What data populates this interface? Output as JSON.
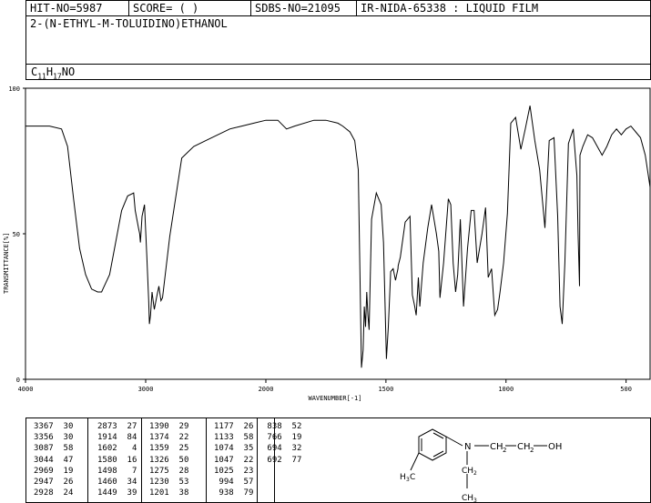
{
  "header": {
    "hit_no": "HIT-NO=5987",
    "score": "SCORE=  (   )",
    "sdbs_no": "SDBS-NO=21095",
    "ir_nida": "IR-NIDA-65338 : LIQUID FILM"
  },
  "compound_name": "2-(N-ETHYL-M-TOLUIDINO)ETHANOL",
  "formula": {
    "c": "C",
    "c_sub": "11",
    "h": "H",
    "h_sub": "17",
    "rest": "NO"
  },
  "chart_data": {
    "type": "line",
    "xlabel": "WAVENUMBER[-1]",
    "ylabel": "TRANSMITTANCE[%]",
    "xlim": [
      4000,
      400
    ],
    "ylim": [
      0,
      100
    ],
    "x_ticks": [
      4000,
      3000,
      2000,
      1500,
      1000,
      500
    ],
    "y_ticks": [
      0,
      50,
      100
    ],
    "series": [
      {
        "x": [
          4000,
          3900,
          3800,
          3700,
          3650,
          3600,
          3550,
          3500,
          3450,
          3400,
          3367,
          3356,
          3300,
          3250,
          3200,
          3150,
          3100,
          3087,
          3060,
          3050,
          3044,
          3030,
          3010,
          2990,
          2975,
          2969,
          2960,
          2947,
          2935,
          2928,
          2910,
          2890,
          2873,
          2860,
          2800,
          2700,
          2600,
          2500,
          2400,
          2300,
          2200,
          2100,
          2000,
          1950,
          1914,
          1880,
          1800,
          1750,
          1700,
          1680,
          1650,
          1630,
          1615,
          1602,
          1595,
          1590,
          1585,
          1580,
          1575,
          1570,
          1560,
          1540,
          1520,
          1510,
          1498,
          1490,
          1480,
          1470,
          1460,
          1450,
          1449,
          1440,
          1420,
          1400,
          1390,
          1380,
          1374,
          1365,
          1359,
          1345,
          1326,
          1310,
          1290,
          1280,
          1275,
          1260,
          1240,
          1230,
          1220,
          1210,
          1201,
          1190,
          1177,
          1160,
          1145,
          1133,
          1120,
          1100,
          1085,
          1074,
          1060,
          1047,
          1035,
          1025,
          1010,
          994,
          980,
          960,
          938,
          920,
          900,
          880,
          860,
          838,
          820,
          800,
          785,
          775,
          766,
          755,
          740,
          720,
          705,
          700,
          694,
          692,
          680,
          660,
          640,
          620,
          600,
          580,
          560,
          540,
          520,
          500,
          480,
          460,
          440,
          420,
          400
        ],
        "y": [
          87,
          87,
          87,
          86,
          80,
          62,
          45,
          36,
          31,
          30,
          30,
          31,
          36,
          47,
          58,
          63,
          64,
          58,
          52,
          50,
          47,
          56,
          60,
          42,
          27,
          19,
          22,
          30,
          26,
          24,
          28,
          32,
          27,
          28,
          49,
          76,
          80,
          82,
          84,
          86,
          87,
          88,
          89,
          89,
          86,
          87,
          89,
          89,
          88,
          87,
          85,
          82,
          72,
          4,
          10,
          25,
          18,
          30,
          22,
          17,
          55,
          64,
          60,
          47,
          7,
          18,
          37,
          38,
          34,
          38,
          39,
          42,
          54,
          56,
          29,
          25,
          22,
          35,
          25,
          40,
          52,
          60,
          50,
          44,
          28,
          40,
          62,
          60,
          40,
          30,
          36,
          55,
          25,
          45,
          58,
          58,
          40,
          50,
          59,
          35,
          38,
          22,
          24,
          30,
          40,
          57,
          88,
          90,
          79,
          86,
          94,
          82,
          72,
          52,
          82,
          83,
          56,
          25,
          19,
          40,
          81,
          86,
          70,
          50,
          32,
          77,
          80,
          84,
          83,
          80,
          77,
          80,
          84,
          86,
          84,
          86,
          87,
          85,
          83,
          77,
          66
        ]
      }
    ],
    "peak_table": [
      [
        "3367",
        "30"
      ],
      [
        "3356",
        "30"
      ],
      [
        "3087",
        "58"
      ],
      [
        "3044",
        "47"
      ],
      [
        "2969",
        "19"
      ],
      [
        "2947",
        "26"
      ],
      [
        "2928",
        "24"
      ],
      [
        "2873",
        "27"
      ],
      [
        "1914",
        "84"
      ],
      [
        "1602",
        "4"
      ],
      [
        "1580",
        "16"
      ],
      [
        "1498",
        "7"
      ],
      [
        "1460",
        "34"
      ],
      [
        "1449",
        "39"
      ],
      [
        "1390",
        "29"
      ],
      [
        "1374",
        "22"
      ],
      [
        "1359",
        "25"
      ],
      [
        "1326",
        "50"
      ],
      [
        "1275",
        "28"
      ],
      [
        "1230",
        "53"
      ],
      [
        "1201",
        "38"
      ],
      [
        "1177",
        "26"
      ],
      [
        "1133",
        "58"
      ],
      [
        "1074",
        "35"
      ],
      [
        "1047",
        "22"
      ],
      [
        "1025",
        "23"
      ],
      [
        "994",
        "57"
      ],
      [
        "938",
        "79"
      ],
      [
        "838",
        "52"
      ],
      [
        "766",
        "19"
      ],
      [
        "694",
        "32"
      ],
      [
        "692",
        "77"
      ]
    ]
  },
  "structure": {
    "n": "N",
    "ch2_a": "CH",
    "ch2_b": "CH",
    "oh": "OH",
    "two": "2",
    "ch3_left": "H",
    "ch3_left_sub": "3",
    "ch3_left_c": "C",
    "ch2_down": "CH",
    "ch3_down": "CH",
    "three": "3"
  }
}
